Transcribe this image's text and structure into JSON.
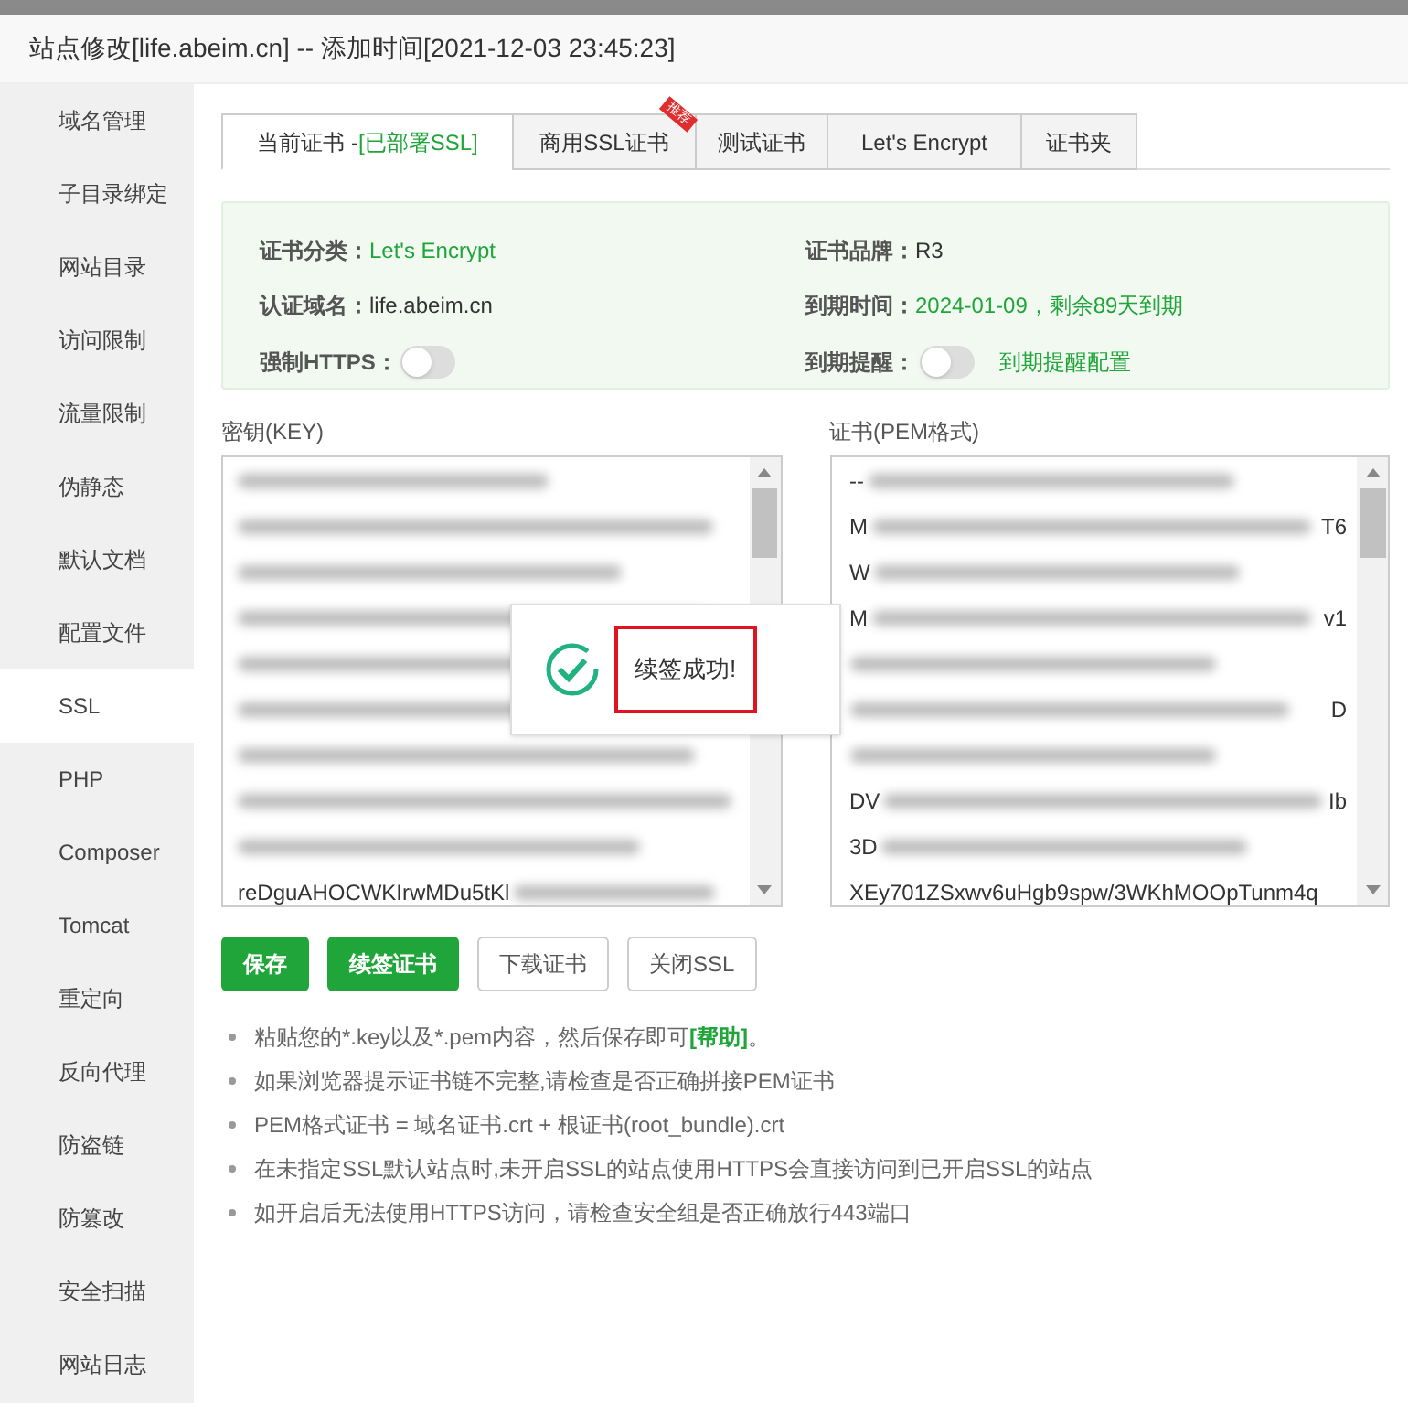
{
  "window": {
    "title": "站点修改[life.abeim.cn] -- 添加时间[2021-12-03 23:45:23]"
  },
  "sidebar": {
    "items": [
      {
        "label": "域名管理",
        "selected": false
      },
      {
        "label": "子目录绑定",
        "selected": false
      },
      {
        "label": "网站目录",
        "selected": false
      },
      {
        "label": "访问限制",
        "selected": false
      },
      {
        "label": "流量限制",
        "selected": false
      },
      {
        "label": "伪静态",
        "selected": false
      },
      {
        "label": "默认文档",
        "selected": false
      },
      {
        "label": "配置文件",
        "selected": false
      },
      {
        "label": "SSL",
        "selected": true
      },
      {
        "label": "PHP",
        "selected": false
      },
      {
        "label": "Composer",
        "selected": false
      },
      {
        "label": "Tomcat",
        "selected": false
      },
      {
        "label": "重定向",
        "selected": false
      },
      {
        "label": "反向代理",
        "selected": false
      },
      {
        "label": "防盗链",
        "selected": false
      },
      {
        "label": "防篡改",
        "selected": false
      },
      {
        "label": "安全扫描",
        "selected": false
      },
      {
        "label": "网站日志",
        "selected": false
      }
    ]
  },
  "tabs": [
    {
      "label": "当前证书 - ",
      "status": "[已部署SSL]",
      "selected": true
    },
    {
      "label": "商用SSL证书",
      "ribbon": "推荐",
      "selected": false
    },
    {
      "label": "测试证书",
      "selected": false
    },
    {
      "label": "Let's Encrypt",
      "selected": false
    },
    {
      "label": "证书夹",
      "selected": false
    }
  ],
  "cert_info": {
    "fields": [
      {
        "label": "证书分类：",
        "value": "Let's Encrypt",
        "highlight": true
      },
      {
        "label": "证书品牌：",
        "value": "R3",
        "highlight": false
      },
      {
        "label": "认证域名：",
        "value": "life.abeim.cn",
        "highlight": false
      },
      {
        "label": "到期时间：",
        "value": "2024-01-09，剩余89天到期",
        "highlight": true
      }
    ],
    "force_https": {
      "label": "强制HTTPS：",
      "on": false
    },
    "expiry_reminder": {
      "label": "到期提醒：",
      "on": false,
      "link": "到期提醒配置"
    }
  },
  "key_box": {
    "label": "密钥(KEY)",
    "last_line": "reDguAHOCWKIrwMDu5tKl"
  },
  "cert_box": {
    "label": "证书(PEM格式)",
    "lines": [
      {
        "kind": "partial",
        "start": "--"
      },
      {
        "kind": "partial",
        "start": "M",
        "end": "T6"
      },
      {
        "kind": "partial",
        "start": "W"
      },
      {
        "kind": "partial",
        "start": "M",
        "end": "v1"
      },
      {
        "kind": "blurred"
      },
      {
        "kind": "partial",
        "end": "D"
      },
      {
        "kind": "blurred"
      },
      {
        "kind": "partial",
        "start": "DV",
        "end": "Ib"
      },
      {
        "kind": "partial",
        "start": "3D"
      },
      {
        "kind": "plain",
        "start": "XEy701ZSxwv6uHgb9spw/3WKhMOOpTunm4q"
      }
    ]
  },
  "buttons": [
    {
      "label": "保存",
      "primary": true
    },
    {
      "label": "续签证书",
      "primary": true
    },
    {
      "label": "下载证书",
      "primary": false
    },
    {
      "label": "关闭SSL",
      "primary": false
    }
  ],
  "notes": [
    {
      "text": "粘贴您的*.key以及*.pem内容，然后保存即可",
      "link": "[帮助]",
      "tail": "。"
    },
    {
      "text": "如果浏览器提示证书链不完整,请检查是否正确拼接PEM证书"
    },
    {
      "text": "PEM格式证书 = 域名证书.crt + 根证书(root_bundle).crt"
    },
    {
      "text": "在未指定SSL默认站点时,未开启SSL的站点使用HTTPS会直接访问到已开启SSL的站点"
    },
    {
      "text": "如开启后无法使用HTTPS访问，请检查安全组是否正确放行443端口"
    }
  ],
  "toast": {
    "message": "续签成功!"
  }
}
